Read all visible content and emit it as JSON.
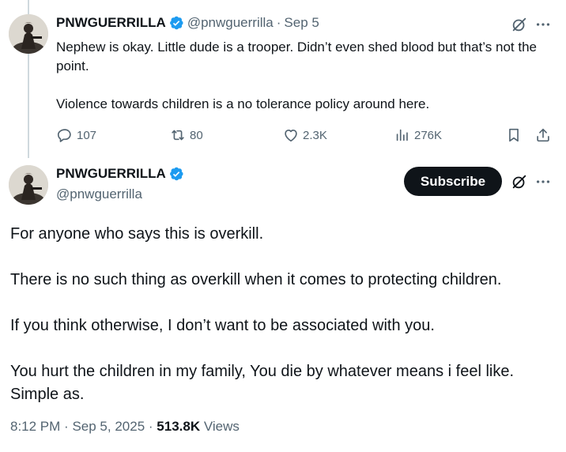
{
  "reply": {
    "display_name": "PNWGUERRILLA",
    "handle": "@pnwguerrilla",
    "separator": "·",
    "date": "Sep 5",
    "paragraphs": [
      "Nephew is okay. Little dude is a trooper. Didn’t even shed blood but that’s not the point.",
      "Violence towards children is a no tolerance policy around here."
    ],
    "actions": {
      "replies": "107",
      "reposts": "80",
      "likes": "2.3K",
      "views": "276K"
    }
  },
  "main": {
    "display_name": "PNWGUERRILLA",
    "handle": "@pnwguerrilla",
    "subscribe_label": "Subscribe",
    "paragraphs": [
      "For anyone who says this is overkill.",
      "There is no such thing as overkill when it comes to protecting children.",
      "If you think otherwise, I don’t want to be associated with you.",
      "You hurt the children in my family, You die by whatever means i feel like. Simple as."
    ],
    "time": "8:12 PM",
    "sep1": "·",
    "date": "Sep 5, 2025",
    "sep2": "·",
    "views_count": "513.8K",
    "views_label": "Views"
  },
  "colors": {
    "verified": "#1d9bf0",
    "text": "#0f1419",
    "secondary": "#536471",
    "thread_line": "#cfd9de"
  },
  "icons": [
    "verified-badge-icon",
    "grok-icon",
    "more-icon",
    "reply-icon",
    "repost-icon",
    "like-icon",
    "views-icon",
    "bookmark-icon",
    "share-icon"
  ]
}
